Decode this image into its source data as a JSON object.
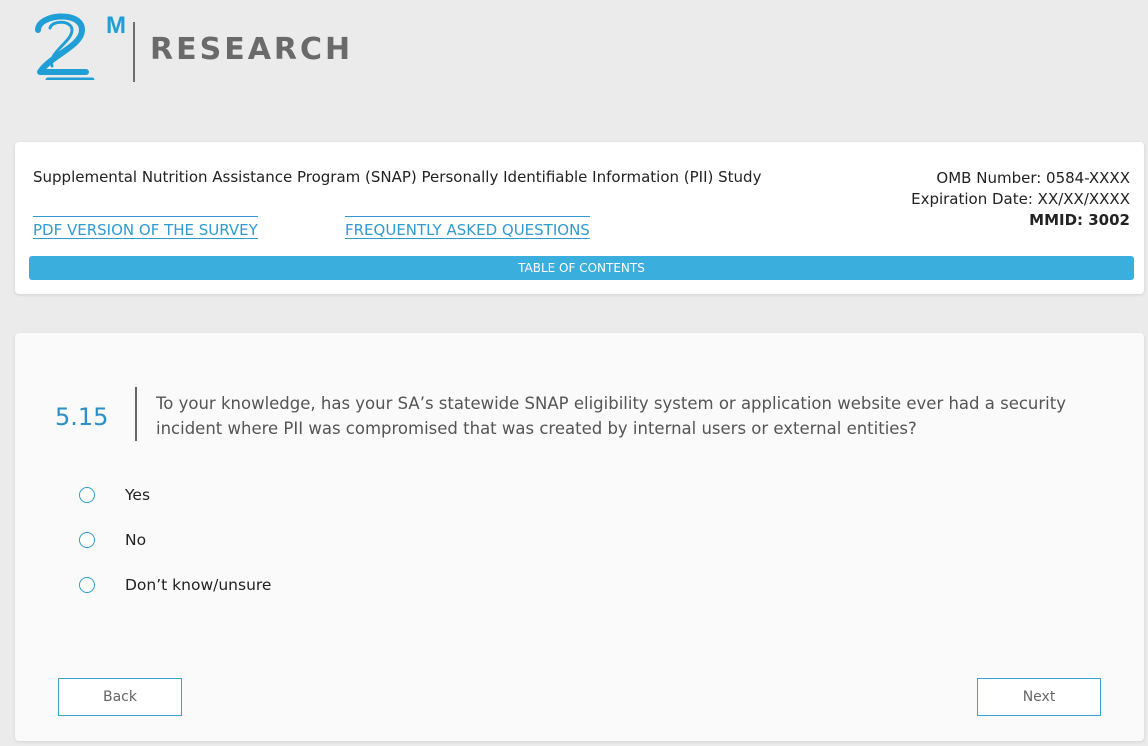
{
  "brand": {
    "logo_superscript": "M",
    "logo_word": "RESEARCH",
    "accent": "#1f9fd6"
  },
  "header": {
    "study_title": "Supplemental Nutrition Assistance Program (SNAP) Personally Identifiable Information (PII) Study",
    "omb_number": "OMB Number: 0584-XXXX",
    "expiration_date": "Expiration Date: XX/XX/XXXX",
    "mmid": "MMID: 3002",
    "links": {
      "pdf": "PDF VERSION OF THE SURVEY",
      "faq": "FREQUENTLY ASKED QUESTIONS"
    },
    "toc_label": "TABLE OF CONTENTS",
    "toc_color": "#3aaedc"
  },
  "question": {
    "number": "5.15",
    "text": "To your knowledge, has your SA’s statewide SNAP eligibility system or application website ever had a security incident where PII was compromised that was created by internal users or external entities?",
    "options": [
      "Yes",
      "No",
      "Don’t know/unsure"
    ]
  },
  "nav": {
    "back_label": "Back",
    "next_label": "Next"
  }
}
